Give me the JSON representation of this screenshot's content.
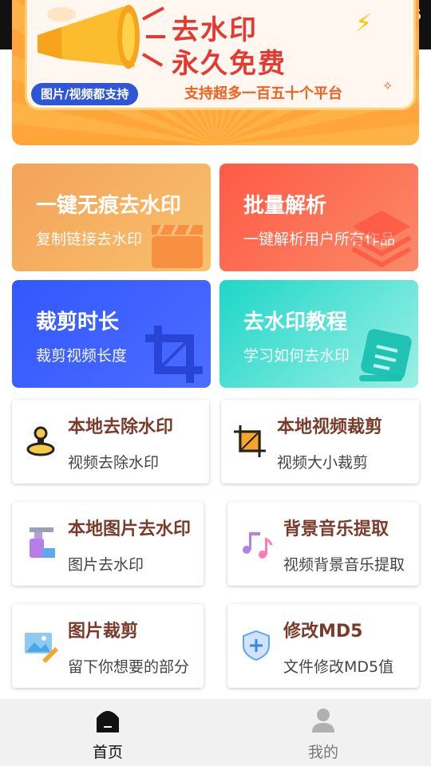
{
  "status_bar": {
    "clock": "56"
  },
  "banner": {
    "headline1": "去水印",
    "headline2": "永久免费",
    "tag": "图片/视频都支持",
    "subtitle": "支持超多一百五十个平台"
  },
  "feature_tiles": [
    {
      "title": "一键无痕去水印",
      "subtitle": "复制链接去水印",
      "icon": "clapperboard-icon",
      "color": "#f4a25a"
    },
    {
      "title": "批量解析",
      "subtitle": "一键解析用户所有作品",
      "icon": "layers-icon",
      "color": "#ff5a45"
    },
    {
      "title": "裁剪时长",
      "subtitle": "裁剪视频长度",
      "icon": "crop-icon",
      "color": "#3257ff"
    },
    {
      "title": "去水印教程",
      "subtitle": "学习如何去水印",
      "icon": "book-icon",
      "color": "#1ed7c8"
    }
  ],
  "tool_cards": [
    {
      "title": "本地去除水印",
      "subtitle": "视频去除水印",
      "icon": "stamp-icon"
    },
    {
      "title": "本地视频裁剪",
      "subtitle": "视频大小裁剪",
      "icon": "crop-frame-icon"
    },
    {
      "title": "本地图片去水印",
      "subtitle": "图片去水印",
      "icon": "eraser-bottle-icon"
    },
    {
      "title": "背景音乐提取",
      "subtitle": "视频背景音乐提取",
      "icon": "music-notes-icon"
    },
    {
      "title": "图片裁剪",
      "subtitle": "留下你想要的部分",
      "icon": "image-edit-icon"
    },
    {
      "title": "修改MD5",
      "subtitle": "文件修改MD5值",
      "icon": "shield-plus-icon"
    }
  ],
  "bottom_nav": {
    "home_label": "首页",
    "mine_label": "我的"
  }
}
